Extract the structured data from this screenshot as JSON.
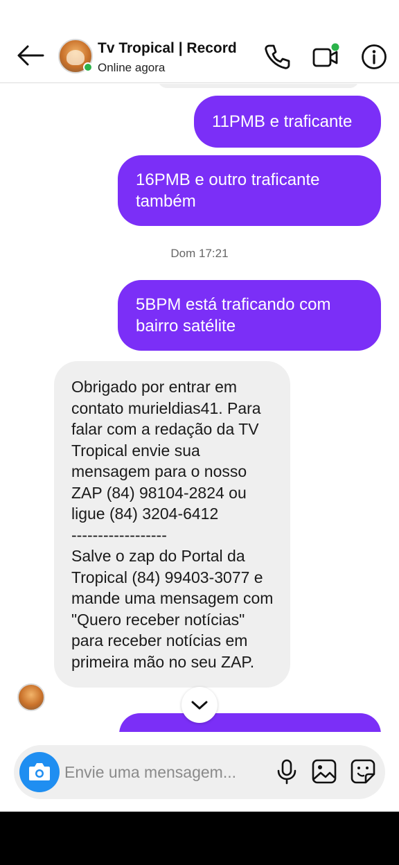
{
  "header": {
    "title": "Tv Tropical | Record",
    "status": "Online agora"
  },
  "messages": [
    {
      "direction": "outgoing",
      "text": "11PMB e traficante"
    },
    {
      "direction": "outgoing",
      "text": "16PMB e outro traficante também"
    },
    {
      "direction": "outgoing",
      "text": "5BPM está traficando com bairro satélite"
    },
    {
      "direction": "incoming",
      "text": "Obrigado por entrar em contato murieldias41. Para falar com a redação da TV Tropical envie sua mensagem para o nosso ZAP (84) 98104-2824 ou ligue (84) 3204-6412\n------------------\nSalve o zap do Portal da Tropical (84) 99403-3077 e mande uma mensagem com \"Quero receber notícias\" para receber notícias em primeira mão no seu ZAP."
    }
  ],
  "timestamp": "Dom 17:21",
  "composer": {
    "placeholder": "Envie uma mensagem..."
  },
  "icons": [
    "back-arrow-icon",
    "phone-icon",
    "video-call-icon",
    "info-icon",
    "camera-icon",
    "microphone-icon",
    "gallery-icon",
    "sticker-icon",
    "chevron-down-icon"
  ],
  "colors": {
    "outgoing_bubble": "#7b2ff7",
    "incoming_bubble": "#efefef",
    "online": "#2bb34a",
    "camera_button": "#1f8ef1"
  }
}
